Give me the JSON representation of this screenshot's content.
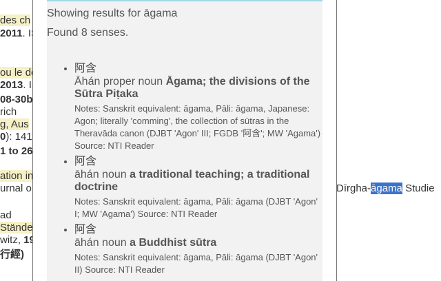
{
  "background": {
    "lines": [
      {
        "pre": "",
        "hl": "des ch",
        "post": ""
      },
      {
        "pre": "",
        "bold": "2011",
        "post": ". IS"
      },
      {
        "pre": "",
        "hl": "ou le de",
        "post": ""
      },
      {
        "pre": "",
        "bold": "2013",
        "post": ". IS"
      },
      {
        "pre": "",
        "bold": "08-30b",
        "post": ""
      },
      {
        "pre": "rich",
        "post": ""
      },
      {
        "pre": "",
        "hl": "g, Aus",
        "post": ""
      },
      {
        "pre": "",
        "bold": "0",
        "post": "): 141"
      },
      {
        "pre": "",
        "bold": "1 to 26",
        "post": ""
      },
      {
        "pre": "",
        "hl": "ation in",
        "post": ""
      },
      {
        "pre": "urnal o",
        "post": ""
      },
      {
        "pre": "ad",
        "post": ""
      },
      {
        "pre": "",
        "hl": "Stände",
        "post": ""
      },
      {
        "pre": "witz, ",
        "bold": "19",
        "post": ""
      },
      {
        "pre": "",
        "bold": "行經)",
        "post": ""
      }
    ],
    "right_text": {
      "pre": "Dīrgha-",
      "sel": "āgama",
      "post": " Studie"
    }
  },
  "popup": {
    "showing": "Showing results for āgama",
    "found": "Found 8 senses.",
    "senses": [
      {
        "chinese": "阿含",
        "pinyin": "Āhán",
        "pos": "proper noun",
        "gloss": "Āgama; the divisions of the Sūtra Piṭaka",
        "notes": "Notes: Sanskrit equivalent: āgama, Pāli: āgama, Japanese: Agon; literally 'comming', the collection of sūtras in the Theravāda canon (DJBT 'Agon' III; FGDB '阿含'; MW 'Agama')",
        "source": "Source: NTI Reader"
      },
      {
        "chinese": "阿含",
        "pinyin": "āhán",
        "pos": "noun",
        "gloss": "a traditional teaching; a traditional doctrine",
        "notes": "Notes: Sanskrit equivalent: āgama, Pāli: āgama (DJBT 'Agon' I; MW 'Agama')",
        "source": "Source: NTI Reader"
      },
      {
        "chinese": "阿含",
        "pinyin": "āhán",
        "pos": "noun",
        "gloss": "a Buddhist sūtra",
        "notes": "Notes: Sanskrit equivalent: āgama, Pāli: āgama (DJBT 'Agon' II)",
        "source": "Source: NTI Reader"
      }
    ]
  },
  "colors": {
    "highlight": "#f6f0c6",
    "selection": "#3b73c8",
    "popup_topbar": "#9fd8e6",
    "popup_bg": "#f2f2f2"
  }
}
